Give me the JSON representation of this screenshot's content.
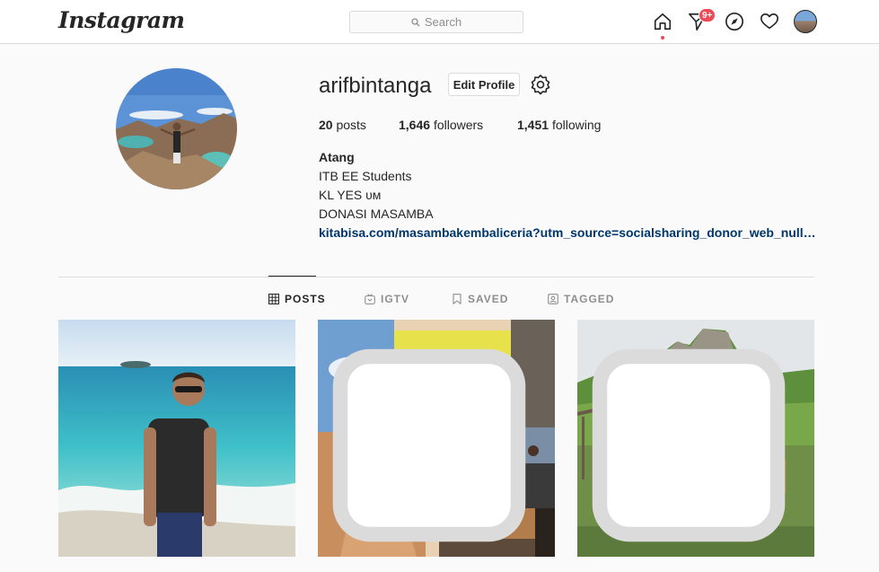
{
  "app": {
    "logo_text": "Instagram"
  },
  "search": {
    "placeholder": "Search"
  },
  "nav": {
    "icons": [
      "home-icon",
      "direct-icon",
      "explore-icon",
      "activity-icon",
      "profile-avatar"
    ],
    "direct_badge": "9+"
  },
  "profile": {
    "username": "arifbintanga",
    "edit_label": "Edit Profile",
    "stats": {
      "posts_count": "20",
      "posts_label": "posts",
      "followers_count": "1,646",
      "followers_label": "followers",
      "following_count": "1,451",
      "following_label": "following"
    },
    "full_name": "Atang",
    "bio": [
      "ITB EE Students",
      "KL YES ᴜᴍ",
      "DONASI MASAMBA"
    ],
    "link": "kitabisa.com/masambakembaliceria?utm_source=socialsharing_donor_web_null&u..."
  },
  "tabs": [
    {
      "label": "POSTS",
      "icon": "grid-icon",
      "active": true
    },
    {
      "label": "IGTV",
      "icon": "igtv-icon",
      "active": false
    },
    {
      "label": "SAVED",
      "icon": "bookmark-icon",
      "active": false
    },
    {
      "label": "TAGGED",
      "icon": "tagged-icon",
      "active": false
    }
  ],
  "colors": {
    "badge": "#ed4956",
    "link": "#00376b",
    "border": "#dbdbdb",
    "muted": "#8e8e8e"
  }
}
